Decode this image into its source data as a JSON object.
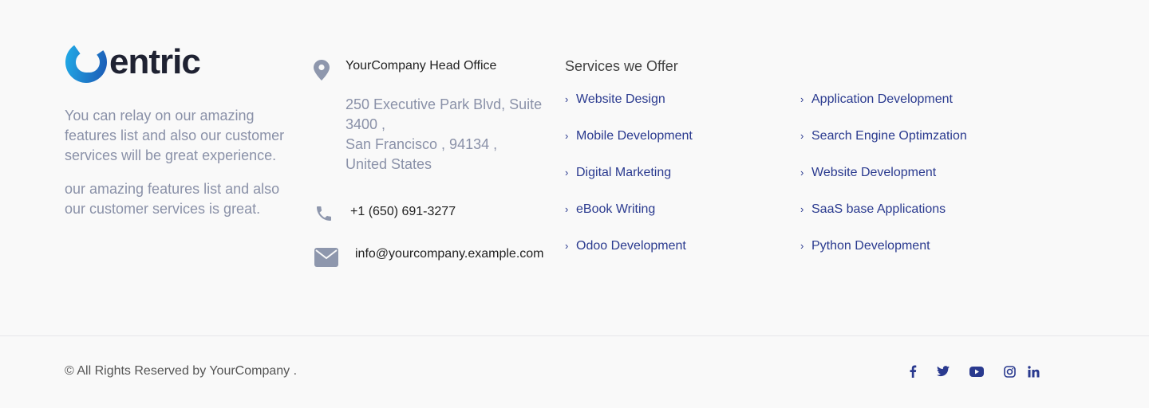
{
  "brand": {
    "name": "entric",
    "logo_colors": [
      "#1d9ee0",
      "#1b5fb5"
    ],
    "text_color": "#1f2232"
  },
  "about": {
    "paragraph1": "You can relay on our amazing features list and also our customer services will be great experience.",
    "paragraph2": "our amazing features list and also our customer services is great."
  },
  "contact": {
    "office_title": "YourCompany Head Office",
    "address_lines": [
      "250 Executive Park Blvd, Suite",
      "3400 ,",
      "San Francisco , 94134 ,",
      "United States"
    ],
    "phone": "+1 (650) 691-3277",
    "email": "info@yourcompany.example.com",
    "icons": [
      "map-pin-icon",
      "phone-icon",
      "envelope-icon"
    ]
  },
  "services": {
    "title": "Services we Offer",
    "column1": [
      "Website Design",
      "Mobile Development",
      "Digital Marketing",
      "eBook Writing",
      "Odoo Development"
    ],
    "column2": [
      "Application Development",
      "Search Engine Optimzation",
      "Website Development",
      "SaaS base Applications",
      "Python Development"
    ]
  },
  "footer": {
    "copyright": "© All Rights Reserved by YourCompany .",
    "social": [
      "facebook-icon",
      "twitter-icon",
      "youtube-icon",
      "instagram-icon",
      "linkedin-icon"
    ]
  },
  "colors": {
    "link": "#2a3a8f",
    "muted_text": "#8a91a8",
    "background": "#f9f9f9",
    "icon_gray": "#8e97ad"
  }
}
